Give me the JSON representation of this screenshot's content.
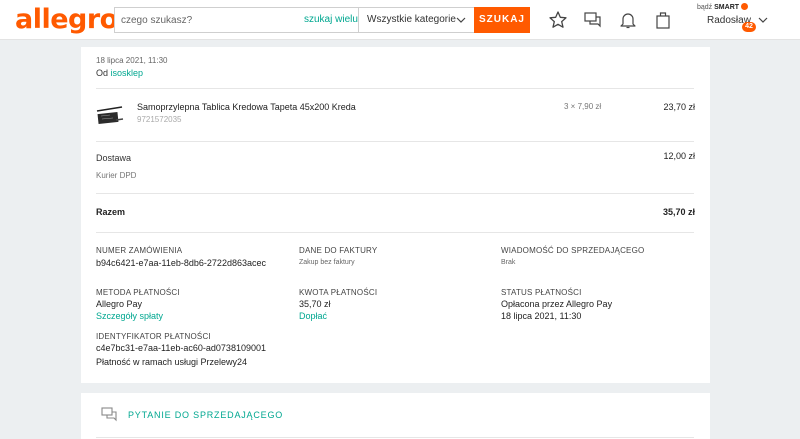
{
  "header": {
    "logo": "allegro",
    "search_placeholder": "czego szukasz?",
    "search_many": "szukaj wielu",
    "category": "Wszystkie kategorie",
    "search_button": "SZUKAJ",
    "smart_prefix": "bądź",
    "smart_brand": "SMART",
    "user_name": "Radosław",
    "badge_count": "42",
    "icons": [
      "star-icon",
      "chat-icon",
      "bell-icon",
      "cart-icon"
    ],
    "accent": "#ff5a00"
  },
  "order": {
    "date": "18 lipca 2021, 11:30",
    "from_prefix": "Od",
    "seller": "isosklep",
    "product": {
      "name": "Samoprzylepna Tablica Kredowa Tapeta 45x200 Kreda",
      "id": "9721572035",
      "qty_price": "3 × 7,90 zł",
      "total": "23,70 zł"
    },
    "shipping": {
      "label": "Dostawa",
      "price": "12,00 zł",
      "method": "Kurier DPD"
    },
    "sum": {
      "label": "Razem",
      "value": "35,70 zł"
    },
    "details": {
      "order_number_label": "NUMER ZAMÓWIENIA",
      "order_number": "b94c6421-e7aa-11eb-8db6-2722d863acec",
      "invoice_label": "DANE DO FAKTURY",
      "invoice_value": "Zakup bez faktury",
      "message_label": "WIADOMOŚĆ DO SPRZEDAJĄCEGO",
      "message_value": "Brak",
      "payment_method_label": "METODA PŁATNOŚCI",
      "payment_method": "Allegro Pay",
      "payment_details_link": "Szczegóły spłaty",
      "payment_amount_label": "KWOTA PŁATNOŚCI",
      "payment_amount": "35,70 zł",
      "surcharge_link": "Dopłać",
      "payment_status_label": "STATUS PŁATNOŚCI",
      "payment_status": "Opłacona przez Allegro Pay",
      "payment_status_date": "18 lipca 2021, 11:30",
      "payment_id_label": "IDENTYFIKATOR PŁATNOŚCI",
      "payment_id": "c4e7bc31-e7aa-11eb-ac60-ad0738109001",
      "payment_service": "Płatność w ramach usługi Przelewy24"
    }
  },
  "question": {
    "label": "PYTANIE DO SPRZEDAJĄCEGO"
  }
}
